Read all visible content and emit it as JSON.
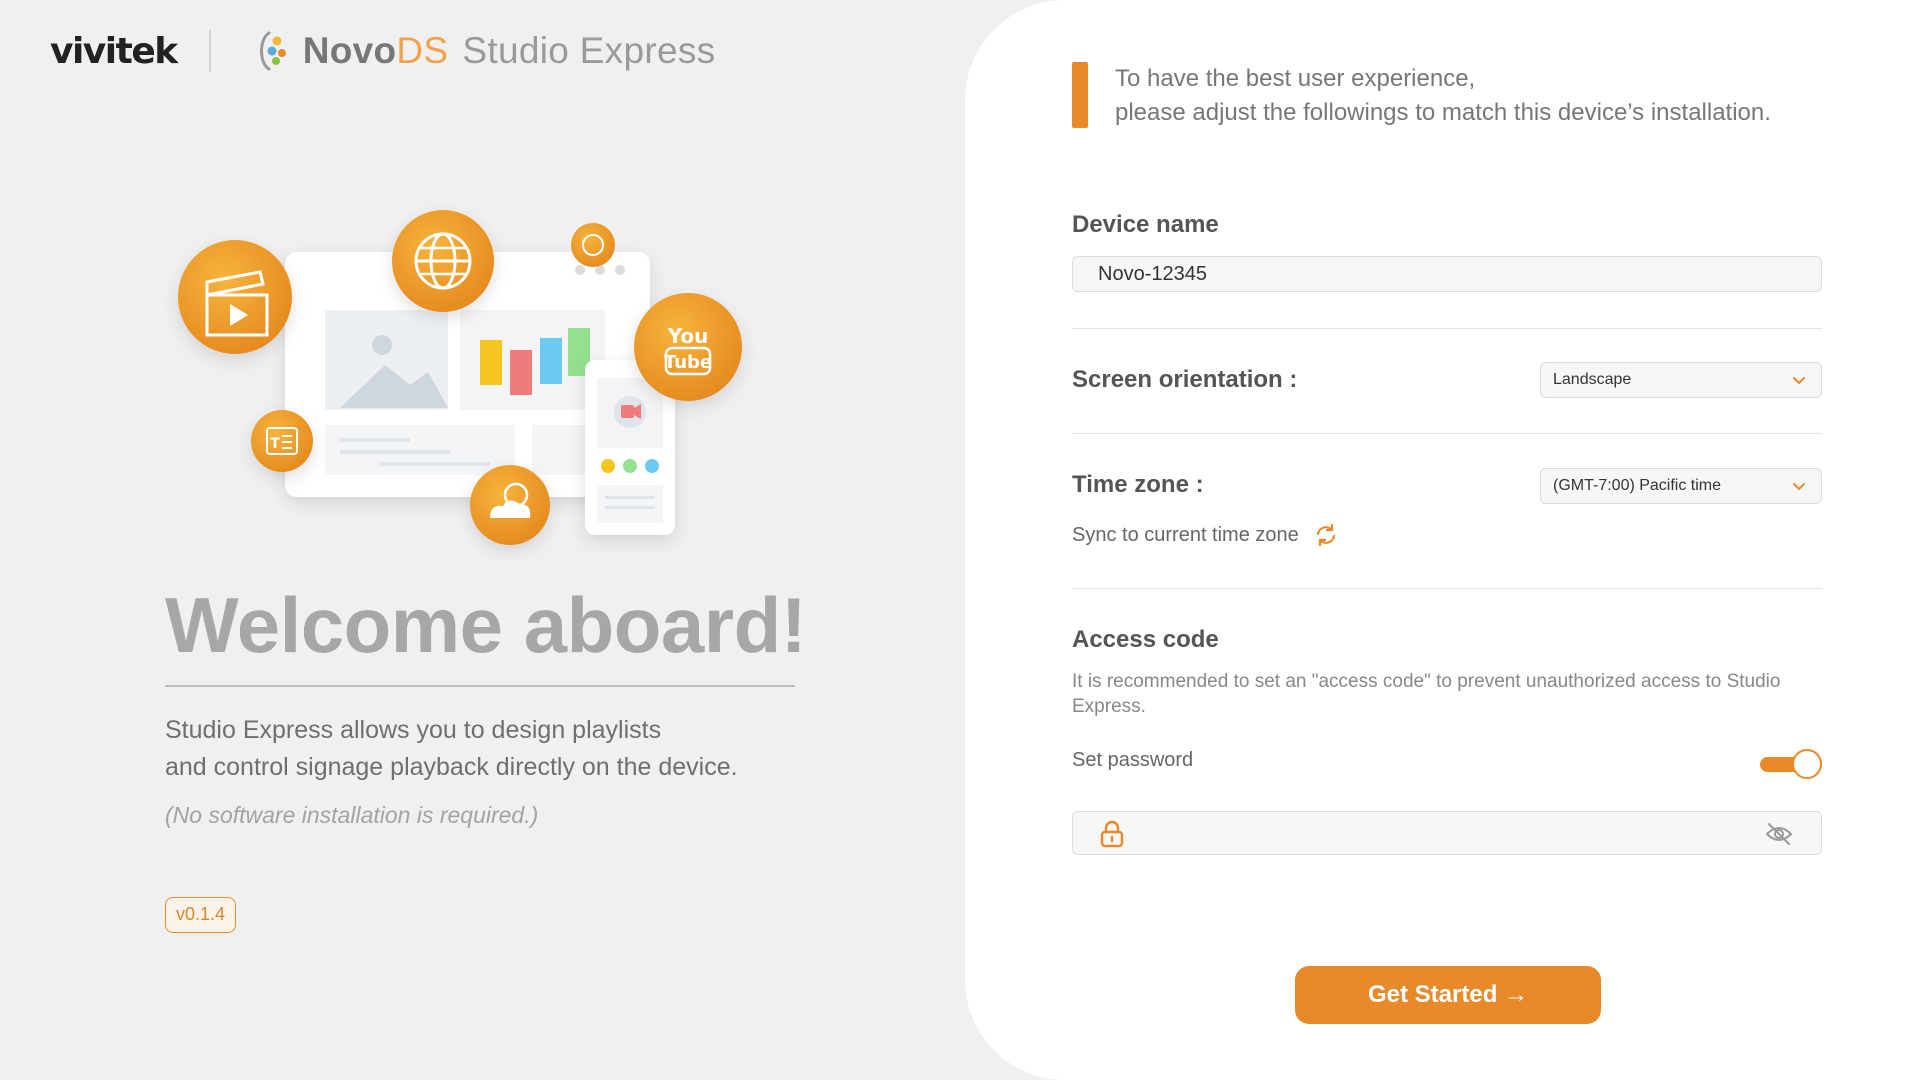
{
  "brand": {
    "company": "vivitek",
    "product_novo": "Novo",
    "product_ds": "DS",
    "product_rest": "Studio Express"
  },
  "welcome": {
    "title": "Welcome aboard!",
    "description_line1": "Studio Express allows you to design playlists",
    "description_line2": "and control signage playback directly on the device.",
    "note": "(No software installation is required.)",
    "version": "v0.1.4"
  },
  "setup": {
    "intro_line1": "To have the best user experience,",
    "intro_line2": "please adjust the followings to match this device’s installation.",
    "device_name": {
      "label": "Device name",
      "value": "Novo-12345"
    },
    "orientation": {
      "label": "Screen orientation :",
      "value": "Landscape"
    },
    "timezone": {
      "label": "Time zone :",
      "value": "(GMT-7:00) Pacific time",
      "sync_label": "Sync to current time zone"
    },
    "access_code": {
      "label": "Access code",
      "description": "It is recommended to set an \"access code\" to prevent unauthorized access to Studio Express.",
      "set_password_label": "Set password",
      "set_password_enabled": true,
      "password_value": ""
    },
    "cta_label": "Get Started →"
  },
  "colors": {
    "accent": "#e8892a",
    "panel_bg": "#f0f0f0",
    "card_bg": "#ffffff"
  },
  "icons": [
    "novods-logo-icon",
    "clapperboard-icon",
    "globe-icon",
    "youtube-icon",
    "text-icon",
    "weather-icon",
    "sync-icon",
    "lock-icon",
    "eye-off-icon",
    "chevron-down-icon"
  ]
}
